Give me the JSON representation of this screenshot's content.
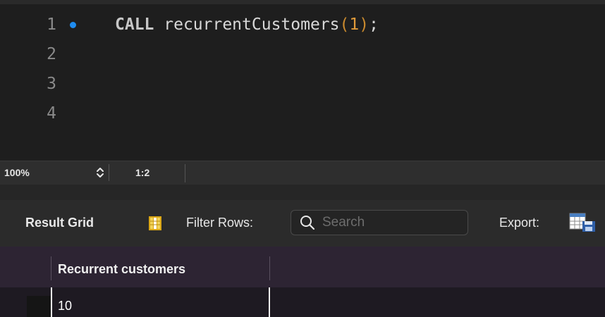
{
  "editor": {
    "lines": [
      {
        "number": "1",
        "has_marker": true
      },
      {
        "number": "2"
      },
      {
        "number": "3"
      },
      {
        "number": "4"
      }
    ],
    "code": {
      "keyword": "CALL",
      "procedure": "recurrentCustomers",
      "open_paren": "(",
      "argument": "1",
      "close_paren": ")",
      "terminator": ";"
    }
  },
  "statusbar": {
    "zoom": "100%",
    "cursor_position": "1:2"
  },
  "result_toolbar": {
    "title": "Result Grid",
    "filter_label": "Filter Rows:",
    "search_placeholder": "Search",
    "export_label": "Export:"
  },
  "result_grid": {
    "columns": [
      "Recurrent customers"
    ],
    "rows": [
      [
        "10"
      ]
    ]
  },
  "colors": {
    "marker": "#1f8cf0",
    "number_literal": "#e09a3a",
    "grid_background": "#2a2230"
  },
  "icons": {
    "grid_toggle": "grid-layout-icon",
    "search": "search-icon",
    "export": "export-table-icon",
    "zoom": "stepper-icon"
  }
}
